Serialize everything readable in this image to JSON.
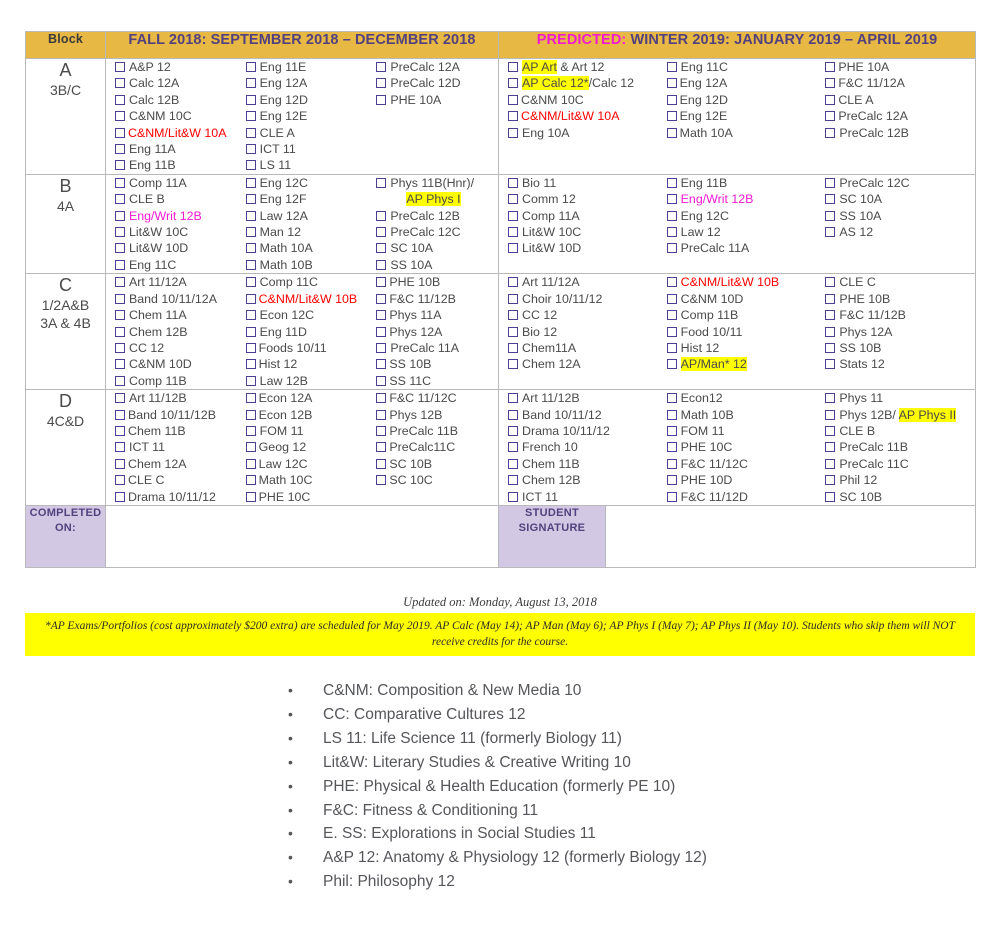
{
  "table": {
    "headers": {
      "block": "Block",
      "fall": "FALL 2018: SEPTEMBER 2018 – DECEMBER 2018",
      "winter_prefix": "PREDICTED:",
      "winter": " WINTER 2019: JANUARY 2019 – APRIL 2019"
    },
    "rows": [
      {
        "block_name": "A",
        "block_sub": "3B/C",
        "fall": [
          [
            {
              "label": "A&P 12"
            },
            {
              "label": "Calc 12A"
            },
            {
              "label": "Calc 12B"
            },
            {
              "label": "C&NM 10C"
            },
            {
              "label": "C&NM/Lit&W 10A",
              "color": "red",
              "tight": true
            },
            {
              "label": "Eng 11A"
            },
            {
              "label": "Eng 11B"
            }
          ],
          [
            {
              "label": "Eng 11E"
            },
            {
              "label": "Eng 12A"
            },
            {
              "label": "Eng 12D"
            },
            {
              "label": "Eng 12E"
            },
            {
              "label": "CLE A"
            },
            {
              "label": "ICT 11"
            },
            {
              "label": "LS 11"
            }
          ],
          [
            {
              "label": "PreCalc 12A"
            },
            {
              "label": "PreCalc 12D"
            },
            {
              "label": "PHE 10A"
            }
          ]
        ],
        "winter": [
          [
            {
              "label": "AP Art",
              "highlight": true,
              "suffix": " & Art 12"
            },
            {
              "label": "AP Calc 12*",
              "highlight": true,
              "suffix": "/Calc 12"
            },
            {
              "label": "C&NM 10C",
              "tight": true
            },
            {
              "label": "C&NM/Lit&W 10A",
              "color": "red",
              "tight": true
            },
            {
              "label": "Eng 10A"
            }
          ],
          [
            {
              "label": "Eng 11C"
            },
            {
              "label": "Eng 12A",
              "tight": true
            },
            {
              "label": "Eng 12D",
              "tight": true
            },
            {
              "label": "Eng 12E",
              "tight": true
            },
            {
              "label": "Math 10A",
              "tight": true
            }
          ],
          [
            {
              "label": "PHE 10A",
              "tight": true
            },
            {
              "label": "F&C 11/12A",
              "tight": true
            },
            {
              "label": "CLE A",
              "tight": true
            },
            {
              "label": "PreCalc 12A",
              "tight": true
            },
            {
              "label": "PreCalc 12B"
            }
          ]
        ]
      },
      {
        "block_name": "B",
        "block_sub": "4A",
        "fall": [
          [
            {
              "label": "Comp 11A"
            },
            {
              "label": "CLE B"
            },
            {
              "label": "Eng/Writ 12B",
              "color": "pink"
            },
            {
              "label": "Lit&W 10C"
            },
            {
              "label": "Lit&W 10D"
            },
            {
              "label": "Eng 11C"
            }
          ],
          [
            {
              "label": "Eng 12C"
            },
            {
              "label": "Eng 12F"
            },
            {
              "label": "Law 12A"
            },
            {
              "label": "Man 12"
            },
            {
              "label": "Math 10A"
            },
            {
              "label": "Math 10B"
            }
          ],
          [
            {
              "label": "Phys 11B(Hnr)/",
              "continuation": "AP Phys I",
              "continuation_highlight": true
            },
            {
              "label": "PreCalc 12B"
            },
            {
              "label": "PreCalc 12C"
            },
            {
              "label": "SC 10A"
            },
            {
              "label": "SS 10A"
            }
          ]
        ],
        "winter": [
          [
            {
              "label": "Bio 11"
            },
            {
              "label": "Comm 12"
            },
            {
              "label": "Comp 11A"
            },
            {
              "label": "Lit&W 10C"
            },
            {
              "label": "Lit&W 10D"
            }
          ],
          [
            {
              "label": "Eng 11B"
            },
            {
              "label": "Eng/Writ 12B",
              "color": "pink"
            },
            {
              "label": "Eng 12C"
            },
            {
              "label": "Law 12"
            },
            {
              "label": "PreCalc 11A"
            }
          ],
          [
            {
              "label": "PreCalc 12C"
            },
            {
              "label": "SC 10A"
            },
            {
              "label": "SS 10A"
            },
            {
              "label": " AS 12"
            }
          ]
        ]
      },
      {
        "block_name": "C",
        "block_sub": "1/2A&B",
        "block_sub2": "3A & 4B",
        "fall": [
          [
            {
              "label": "Art 11/12A"
            },
            {
              "label": "Band 10/11/12A"
            },
            {
              "label": "Chem 11A"
            },
            {
              "label": "Chem 12B"
            },
            {
              "label": "CC 12"
            },
            {
              "label": "C&NM 10D"
            },
            {
              "label": "Comp 11B"
            }
          ],
          [
            {
              "label": "Comp 11C"
            },
            {
              "label": "C&NM/Lit&W 10B",
              "color": "red",
              "tight": true
            },
            {
              "label": "Econ 12C"
            },
            {
              "label": "Eng 11D"
            },
            {
              "label": "Foods 10/11",
              "tight": true
            },
            {
              "label": "Hist 12",
              "tight": true
            },
            {
              "label": "Law 12B"
            }
          ],
          [
            {
              "label": "PHE 10B",
              "tight": true
            },
            {
              "label": "F&C 11/12B",
              "tight": true
            },
            {
              "label": "Phys 11A",
              "tight": true
            },
            {
              "label": "Phys 12A",
              "tight": true
            },
            {
              "label": " PreCalc 11A"
            },
            {
              "label": "SS 10B",
              "tight": true
            },
            {
              "label": "SS 11C",
              "tight": true
            }
          ]
        ],
        "winter": [
          [
            {
              "label": "Art 11/12A"
            },
            {
              "label": "Choir 10/11/12"
            },
            {
              "label": "CC 12"
            },
            {
              "label": "Bio 12"
            },
            {
              "label": "Chem11A"
            },
            {
              "label": "Chem 12A"
            }
          ],
          [
            {
              "label": "C&NM/Lit&W 10B",
              "color": "red"
            },
            {
              "label": "C&NM 10D"
            },
            {
              "label": "Comp 11B"
            },
            {
              "label": "Food 10/11"
            },
            {
              "label": "Hist 12"
            },
            {
              "label": "AP/Man* 12",
              "highlight": true
            }
          ],
          [
            {
              "label": "CLE C"
            },
            {
              "label": "PHE 10B"
            },
            {
              "label": "F&C 11/12B"
            },
            {
              "label": "Phys 12A"
            },
            {
              "label": "SS 10B"
            },
            {
              "label": "Stats 12"
            }
          ]
        ]
      },
      {
        "block_name": "D",
        "block_sub": "4C&D",
        "fall": [
          [
            {
              "label": "Art 11/12B"
            },
            {
              "label": "Band 10/11/12B",
              "tight": true
            },
            {
              "label": "Chem 11B",
              "tight": true
            },
            {
              "label": " ICT 11"
            },
            {
              "label": "Chem 12A",
              "tight": true
            },
            {
              "label": "CLE C",
              "tight": true
            },
            {
              "label": "Drama 10/11/12",
              "tight": true
            }
          ],
          [
            {
              "label": "Econ 12A",
              "tight": true
            },
            {
              "label": "Econ 12B",
              "tight": true
            },
            {
              "label": " FOM 11"
            },
            {
              "label": "Geog 12",
              "tight": true
            },
            {
              "label": "Law 12C",
              "tight": true
            },
            {
              "label": "Math 10C",
              "tight": true
            },
            {
              "label": "PHE 10C",
              "tight": true
            }
          ],
          [
            {
              "label": "F&C 11/12C",
              "tight": true
            },
            {
              "label": "Phys 12B",
              "tight": true
            },
            {
              "label": "PreCalc 11B",
              "tight": true
            },
            {
              "label": "PreCalc11C",
              "tight": true
            },
            {
              "label": "SC 10B",
              "tight": true
            },
            {
              "label": "SC 10C",
              "tight": true
            }
          ]
        ],
        "winter": [
          [
            {
              "label": "Art 11/12B"
            },
            {
              "label": "Band 10/11/12"
            },
            {
              "label": "Drama 10/11/12"
            },
            {
              "label": "French 10"
            },
            {
              "label": "Chem 11B"
            },
            {
              "label": "Chem 12B"
            },
            {
              "label": "ICT 11"
            }
          ],
          [
            {
              "label": "Econ12"
            },
            {
              "label": "Math 10B"
            },
            {
              "label": "FOM 11"
            },
            {
              "label": "PHE 10C"
            },
            {
              "label": "F&C 11/12C"
            },
            {
              "label": "PHE 10D"
            },
            {
              "label": "F&C 11/12D"
            }
          ],
          [
            {
              "label": "Phys 11"
            },
            {
              "label": "Phys 12B/ ",
              "suffix_highlight": "AP Phys II"
            },
            {
              "label": "CLE B"
            },
            {
              "label": "PreCalc 11B"
            },
            {
              "label": "PreCalc 11C"
            },
            {
              "label": "Phil 12"
            },
            {
              "label": "SC 10B"
            }
          ]
        ]
      }
    ],
    "footer_row": {
      "completed_on": "COMPLETED ON:",
      "student_signature": "STUDENT SIGNATURE"
    }
  },
  "updated": "Updated on: Monday, August 13, 2018",
  "ap_note": "*AP Exams/Portfolios (cost approximately $200 extra) are scheduled for May 2019. AP Calc (May 14); AP Man (May 6); AP Phys I (May 7); AP Phys II (May 10). Students who skip them will NOT receive credits for the course.",
  "legend": {
    "bullet": "•",
    "items": [
      "C&NM: Composition & New Media 10",
      "CC: Comparative Cultures 12",
      "LS 11: Life Science 11 (formerly Biology 11)",
      "Lit&W: Literary Studies & Creative Writing 10",
      "PHE: Physical & Health Education (formerly PE 10)",
      "F&C: Fitness & Conditioning 11",
      "E. SS: Explorations in Social Studies 11",
      "A&P 12: Anatomy & Physiology 12 (formerly Biology 12)",
      "Phil: Philosophy 12"
    ]
  },
  "colors": {
    "header_bg": "#e8b844",
    "header_text": "#52417e",
    "accent_pink": "#f11ad1",
    "accent_red": "#ff0000",
    "highlight": "#ffff00",
    "lavender": "#d3c8e3",
    "checkbox": "#4b3f95"
  }
}
